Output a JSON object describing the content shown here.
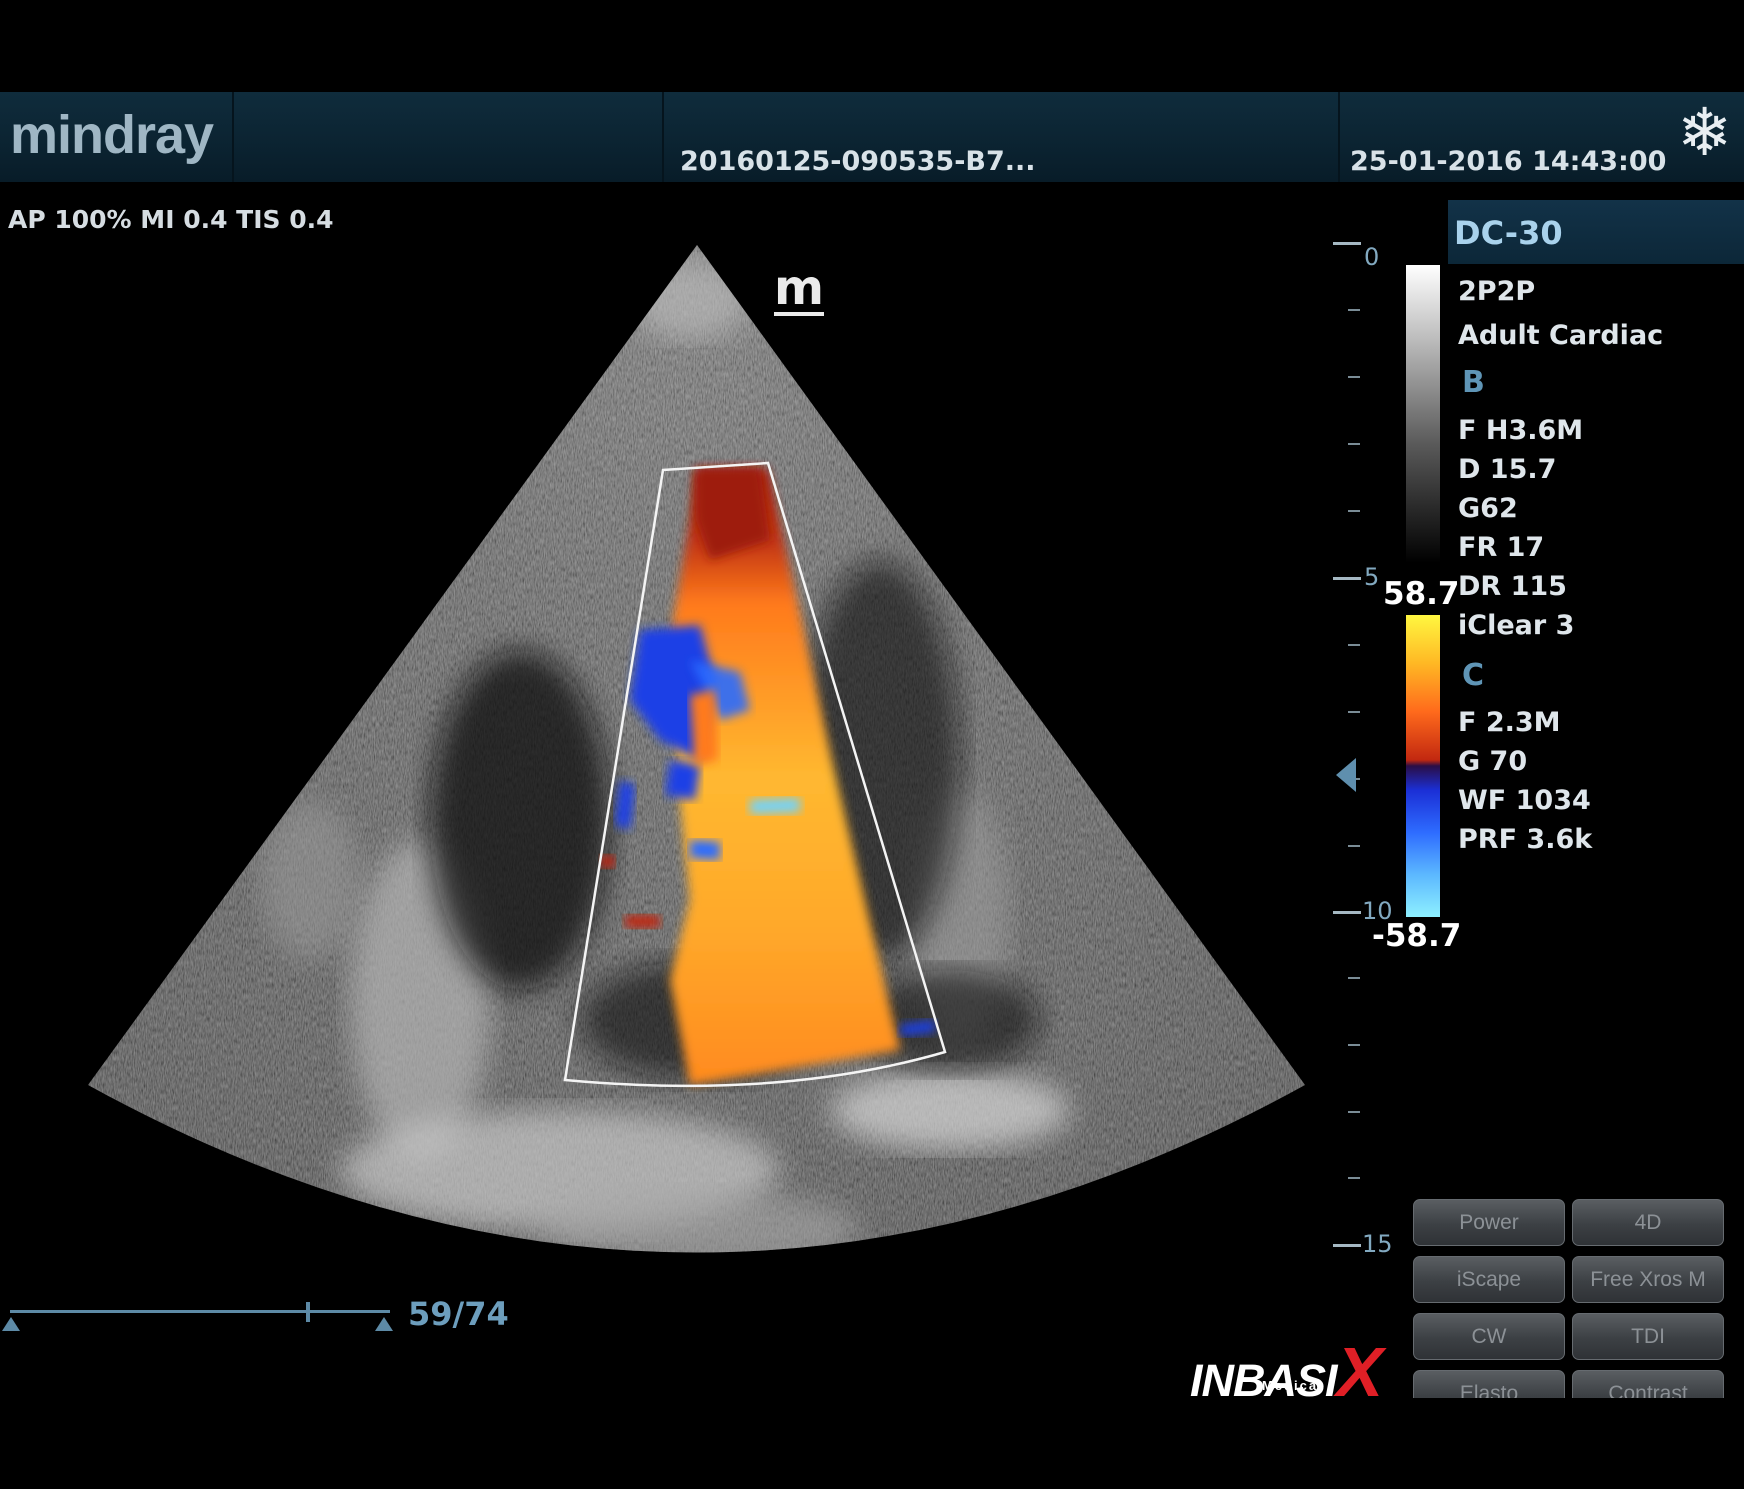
{
  "header": {
    "brand": "mindray",
    "file_id": "20160125-090535-B7...",
    "datetime": "25-01-2016 14:43:00",
    "freeze_icon": "snowflake-icon"
  },
  "acoustic": {
    "power": "AP 100%  MI 0.4 TIS 0.4"
  },
  "probe": {
    "name": "DC-30",
    "preset": "2P2P",
    "exam": "Adult Cardiac"
  },
  "b_mode": {
    "label": "B",
    "params": [
      "F H3.6M",
      "D 15.7",
      "G62",
      "FR 17",
      "DR 115",
      "iClear 3"
    ]
  },
  "c_mode": {
    "label": "C",
    "params": [
      "F 2.3M",
      "G 70",
      "WF 1034",
      "PRF 3.6k"
    ]
  },
  "color_scale": {
    "max": "58.7",
    "min": "-58.7",
    "positive_color": "#ffb824",
    "negative_color": "#2e6cff"
  },
  "depth_scale": {
    "labels": [
      "0",
      "5",
      "10",
      "15"
    ]
  },
  "marker": "m",
  "cine": {
    "frames": "59/74"
  },
  "soft_buttons": [
    "Power",
    "4D",
    "iScape",
    "Free Xros M",
    "CW",
    "TDI",
    "Elasto",
    "Contrast"
  ],
  "watermark": {
    "name": "INBASIX",
    "sub": "Medical"
  }
}
